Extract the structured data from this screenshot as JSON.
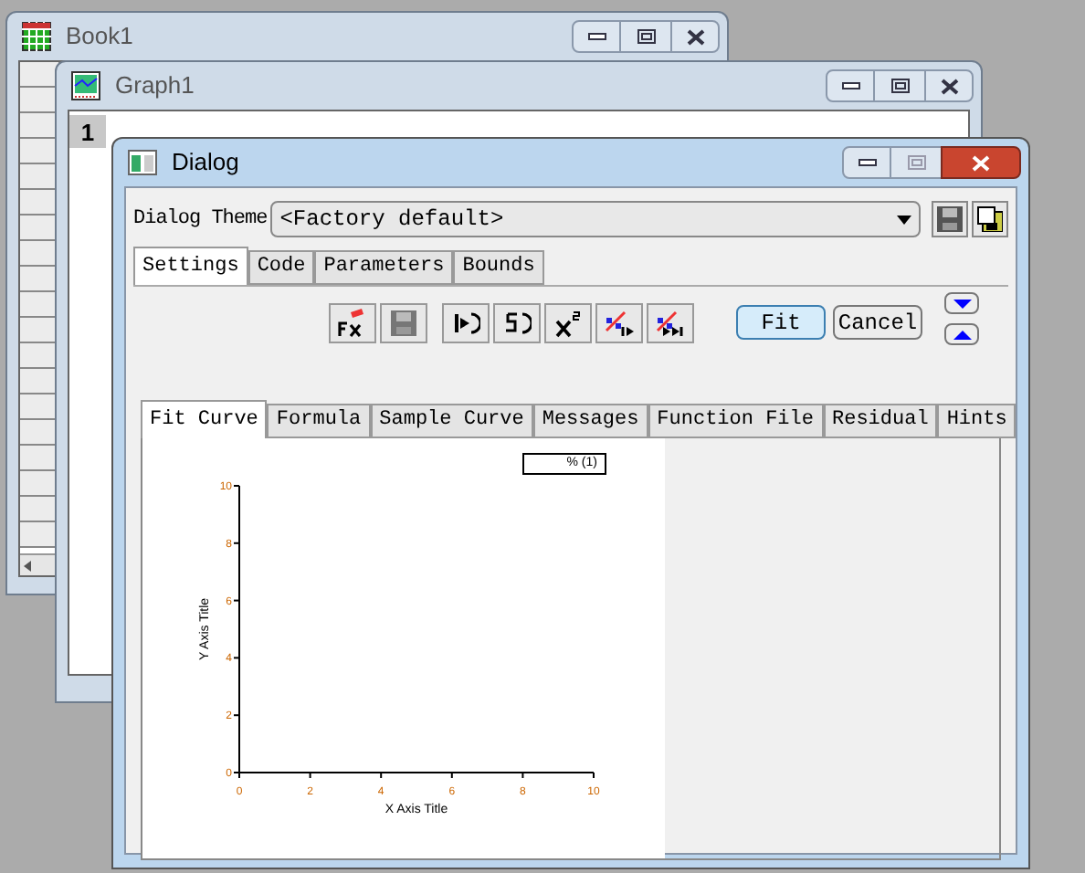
{
  "windows": [
    {
      "kind": "book",
      "title": "Book1",
      "active": false
    },
    {
      "kind": "graph",
      "title": "Graph1",
      "active": false,
      "layer": "1"
    },
    {
      "kind": "dialog",
      "title": "Dialog",
      "active": true
    }
  ],
  "dialog": {
    "theme_label": "Dialog Theme",
    "theme_value": "<Factory default>",
    "tabs": [
      {
        "label": "Settings",
        "selected": true
      },
      {
        "label": "Code",
        "selected": false
      },
      {
        "label": "Parameters",
        "selected": false
      },
      {
        "label": "Bounds",
        "selected": false
      }
    ],
    "actions": [
      {
        "label": "Fit",
        "selected": true
      },
      {
        "label": "Cancel",
        "selected": false
      }
    ],
    "preview_tabs": [
      {
        "label": "Fit Curve",
        "selected": true
      },
      {
        "label": "Formula",
        "selected": false
      },
      {
        "label": "Sample Curve",
        "selected": false
      },
      {
        "label": "Messages",
        "selected": false
      },
      {
        "label": "Function File",
        "selected": false
      },
      {
        "label": "Residual",
        "selected": false
      },
      {
        "label": "Hints",
        "selected": false
      }
    ],
    "plot": {
      "legend": "% (1)",
      "chart_data": {
        "type": "line",
        "xlabel": "X Axis Title",
        "ylabel": "Y Axis Title",
        "xlim": [
          0,
          10
        ],
        "ylim": [
          0,
          10
        ],
        "xticks": [
          0,
          2,
          4,
          6,
          8,
          10
        ],
        "yticks": [
          0,
          2,
          4,
          6,
          8,
          10
        ]
      }
    }
  }
}
